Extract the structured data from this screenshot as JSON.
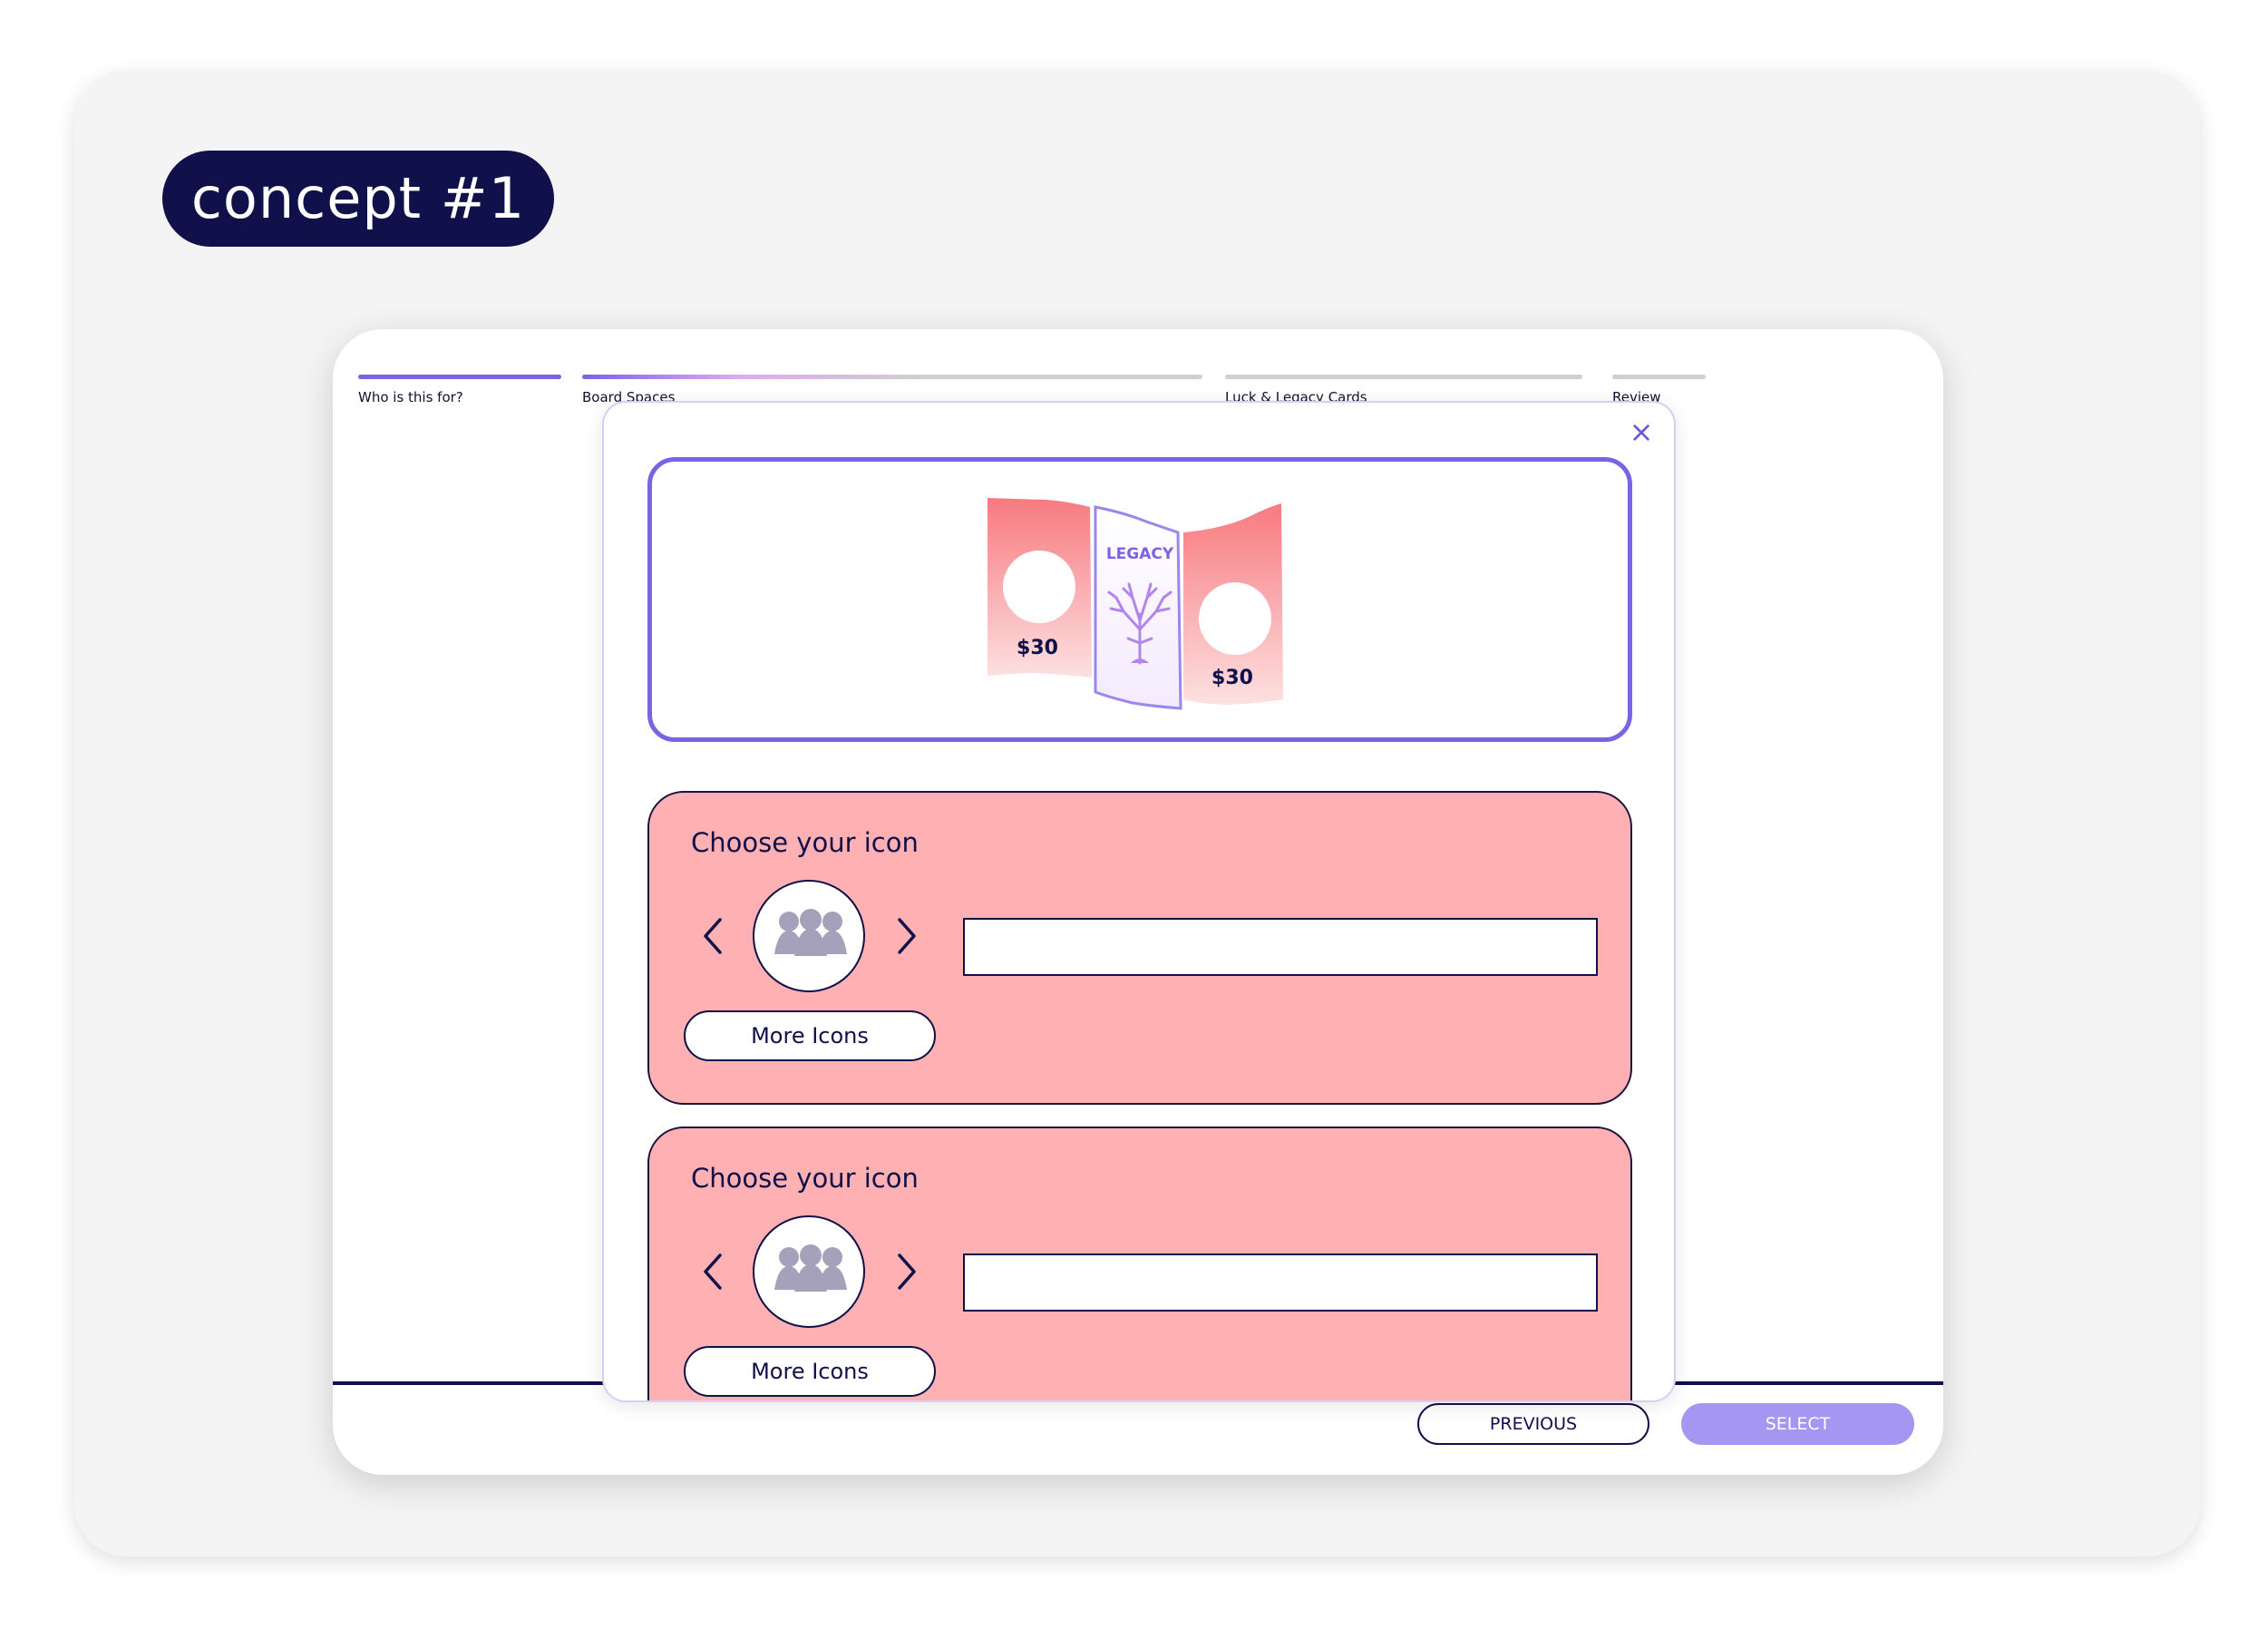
{
  "concept_label": "concept #1",
  "steps": [
    {
      "label": "Who is this for?",
      "state": "complete"
    },
    {
      "label": "Board Spaces",
      "state": "in-progress"
    },
    {
      "label": "Luck & Legacy Cards",
      "state": "pending"
    },
    {
      "label": "Review",
      "state": "pending"
    }
  ],
  "modal": {
    "close_glyph": "×",
    "card_preview": {
      "left_price": "$30",
      "center_title": "LEGACY",
      "right_price": "$30",
      "center_icon": "tree-icon"
    },
    "panels": [
      {
        "title": "Choose your icon",
        "more_label": "More Icons",
        "input_value": "",
        "icon": "people-group-icon"
      },
      {
        "title": "Choose your icon",
        "more_label": "More Icons",
        "input_value": "",
        "icon": "people-group-icon"
      }
    ]
  },
  "footer": {
    "previous_label": "PREVIOUS",
    "select_label": "SELECT"
  },
  "colors": {
    "navy": "#10104a",
    "accent_purple": "#7b63e3",
    "select_button": "#a596f2",
    "panel_pink": "#feb0b2",
    "card_coral": "#f77a7f"
  }
}
